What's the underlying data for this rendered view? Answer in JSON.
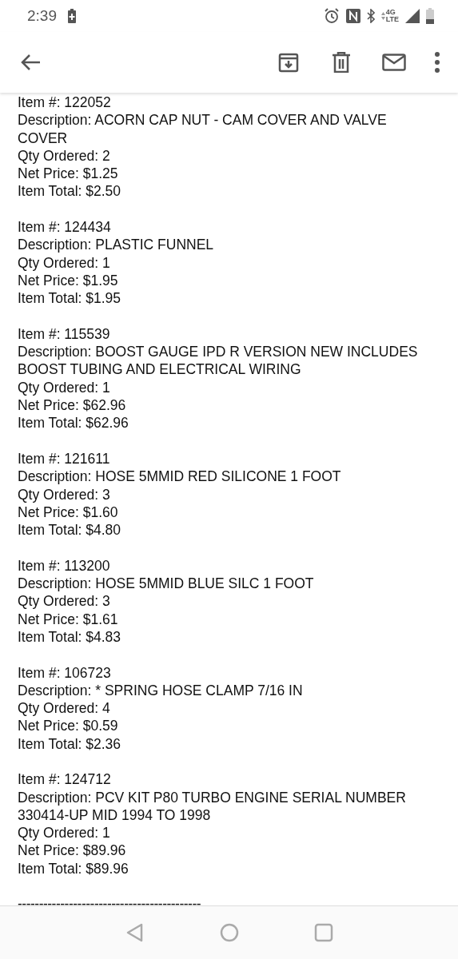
{
  "status_bar": {
    "time": "2:39",
    "network": "4G",
    "network_sub": "LTE"
  },
  "items": [
    {
      "item": "Item #: 122052",
      "description": "Description: ACORN CAP NUT - CAM COVER AND VALVE COVER",
      "qty": "Qty Ordered: 2",
      "net": "Net Price: $1.25",
      "total": "Item Total: $2.50"
    },
    {
      "item": "Item #: 124434",
      "description": "Description: PLASTIC FUNNEL",
      "qty": "Qty Ordered: 1",
      "net": "Net Price: $1.95",
      "total": "Item Total: $1.95"
    },
    {
      "item": "Item #: 115539",
      "description": "Description: BOOST GAUGE IPD R VERSION NEW INCLUDES BOOST TUBING AND ELECTRICAL WIRING",
      "qty": "Qty Ordered: 1",
      "net": "Net Price: $62.96",
      "total": "Item Total: $62.96"
    },
    {
      "item": "Item #: 121611",
      "description": "Description: HOSE 5MMID RED SILICONE 1 FOOT",
      "qty": "Qty Ordered: 3",
      "net": "Net Price: $1.60",
      "total": "Item Total: $4.80"
    },
    {
      "item": "Item #: 113200",
      "description": "Description: HOSE 5MMID BLUE SILC 1 FOOT",
      "qty": "Qty Ordered: 3",
      "net": "Net Price: $1.61",
      "total": "Item Total: $4.83"
    },
    {
      "item": "Item #: 106723",
      "description": "Description: * SPRING HOSE CLAMP 7/16 IN",
      "qty": "Qty Ordered: 4",
      "net": "Net Price: $0.59",
      "total": "Item Total: $2.36"
    },
    {
      "item": "Item #: 124712",
      "description": "Description: PCV KIT P80 TURBO ENGINE SERIAL NUMBER 330414-UP MID 1994 TO 1998",
      "qty": "Qty Ordered: 1",
      "net": "Net Price: $89.96",
      "total": "Item Total: $89.96"
    }
  ],
  "separator": "-------------------------------------------"
}
